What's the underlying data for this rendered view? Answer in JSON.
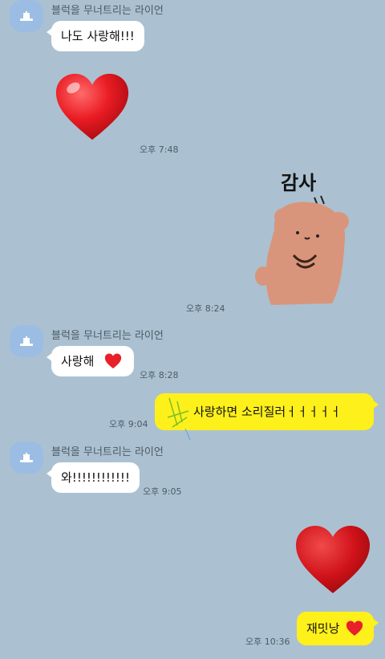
{
  "chat": {
    "sender_name": "블럭을 무너트리는 라이언",
    "messages": [
      {
        "text": "나도 사랑해!!!"
      },
      {
        "time": "오후 7:48"
      },
      {
        "sticker_caption": "감사",
        "time": "오후 8:24"
      },
      {
        "text": "사랑해",
        "time": "오후 8:28"
      },
      {
        "text": "사랑하면 소리질러ㅓㅓㅓㅓㅓ",
        "time": "오후 9:04"
      },
      {
        "text": "와!!!!!!!!!!!!",
        "time": "오후 9:05"
      },
      {
        "text": "재밋낭",
        "time": "오후 10:36"
      }
    ]
  },
  "colors": {
    "background": "#abc1d1",
    "bubble_incoming": "#ffffff",
    "bubble_outgoing": "#fef01b",
    "heart": "#e8202a",
    "sticker_bear": "#d9957c"
  },
  "icons": [
    "default-avatar-icon",
    "heart-emoji",
    "bear-thanks-sticker",
    "heart-emoji-small"
  ]
}
